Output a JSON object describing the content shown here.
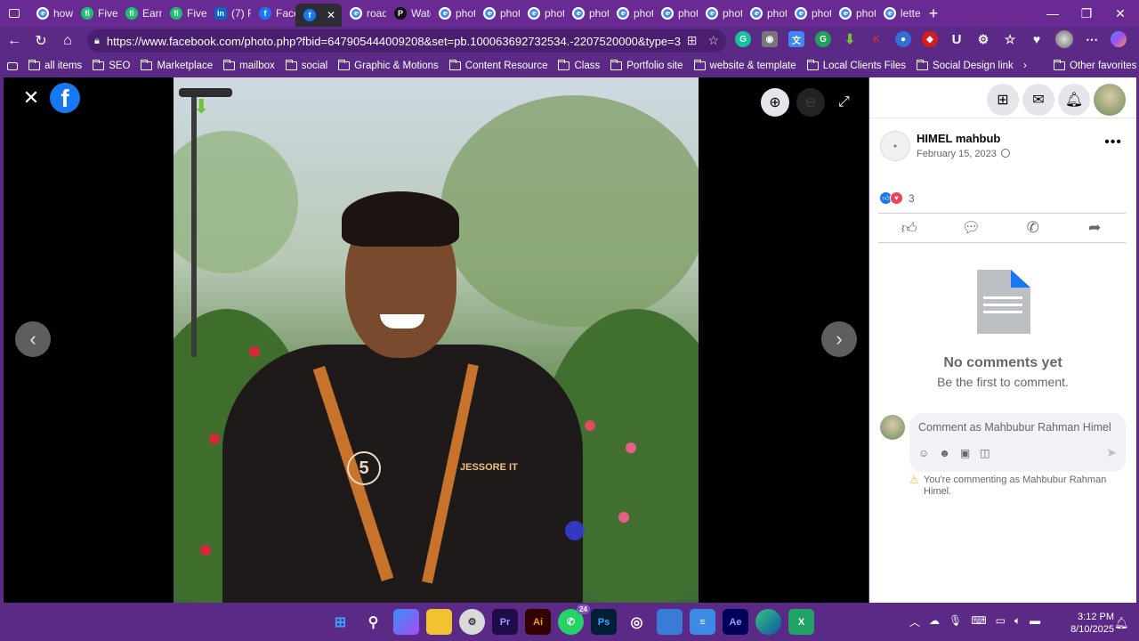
{
  "browser": {
    "tabs": [
      {
        "label": "how",
        "favicon": "google"
      },
      {
        "label": "Fiver",
        "favicon": "fiverr"
      },
      {
        "label": "Earni",
        "favicon": "fiverr"
      },
      {
        "label": "Fiver",
        "favicon": "fiverr"
      },
      {
        "label": "(7) F",
        "favicon": "linkedin"
      },
      {
        "label": "Face",
        "favicon": "facebook"
      },
      {
        "label": "",
        "favicon": "facebook",
        "active": true
      },
      {
        "label": "road",
        "favicon": "google"
      },
      {
        "label": "Watc",
        "favicon": "picsart"
      },
      {
        "label": "phot",
        "favicon": "google"
      },
      {
        "label": "phot",
        "favicon": "google"
      },
      {
        "label": "phot",
        "favicon": "google"
      },
      {
        "label": "phot",
        "favicon": "google"
      },
      {
        "label": "phot",
        "favicon": "google"
      },
      {
        "label": "phot",
        "favicon": "google"
      },
      {
        "label": "phot",
        "favicon": "google"
      },
      {
        "label": "phot",
        "favicon": "google"
      },
      {
        "label": "phot",
        "favicon": "google"
      },
      {
        "label": "phot",
        "favicon": "google"
      },
      {
        "label": "lette",
        "favicon": "google"
      }
    ],
    "new_tab_glyph": "+",
    "window_controls": [
      "—",
      "❐",
      "✕"
    ],
    "url": "https://www.facebook.com/photo.php?fbid=647905444009208&set=pb.100063692732534.-2207520000&type=3",
    "bookmarks": [
      "all items",
      "SEO",
      "Marketplace",
      "mailbox",
      "social",
      "Graphic & Motions",
      "Content Resource",
      "Class",
      "Portfolio site",
      "website & template",
      "Local Clients Files",
      "Social Design link"
    ],
    "other_favorites": "Other favorites"
  },
  "viewer": {
    "close_glyph": "✕",
    "fb_letter": "f",
    "prev_glyph": "‹",
    "next_glyph": "›",
    "zoom_in_glyph": "⊕",
    "zoom_out_glyph": "⊖",
    "fullscreen_glyph": "⤢",
    "shirt_badge": "JESSORE IT",
    "shirt_logo": "5"
  },
  "post": {
    "author": "HIMEL mahbub",
    "date": "February 15, 2023",
    "reaction_count": "3",
    "no_comments_title": "No comments yet",
    "no_comments_sub": "Be the first to comment.",
    "comment_placeholder": "Comment as Mahbubur Rahman Himel",
    "commenting_as_notice": "You're commenting as Mahbubur Rahman Himel."
  },
  "taskbar": {
    "whatsapp_badge": "24",
    "time": "3:12 PM",
    "date": "8/10/2025"
  },
  "colors": {
    "browser_chrome": "#5b2a86",
    "facebook_blue": "#1877f2",
    "love_red": "#f33e58"
  }
}
